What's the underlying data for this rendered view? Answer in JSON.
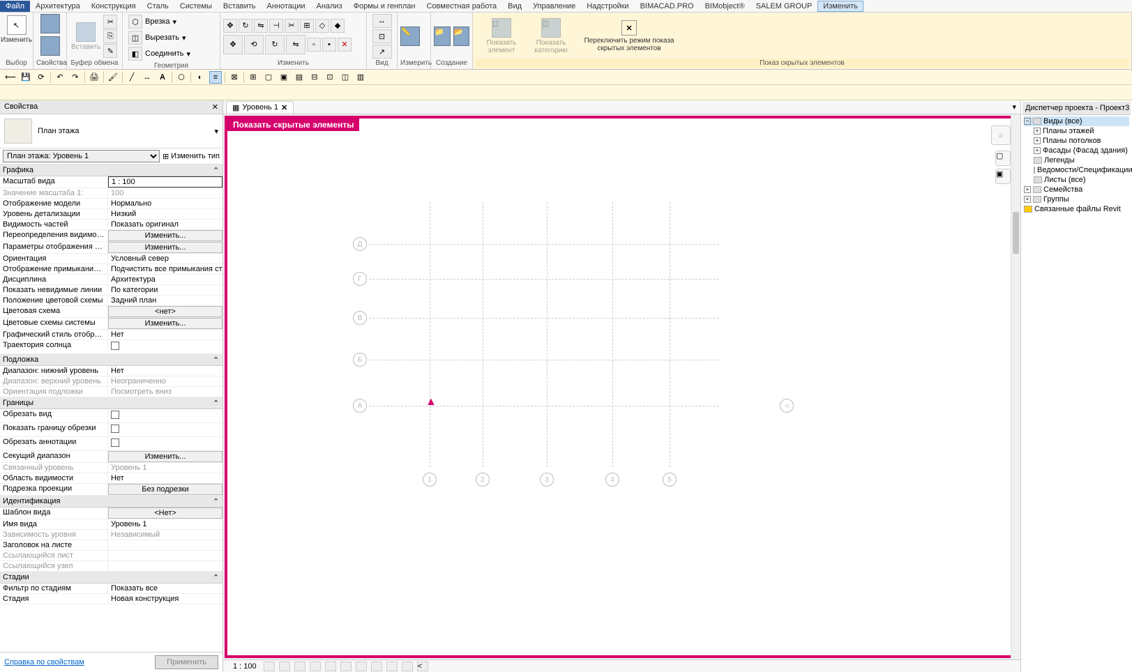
{
  "menubar": {
    "items": [
      "Файл",
      "Архитектура",
      "Конструкция",
      "Сталь",
      "Системы",
      "Вставить",
      "Аннотации",
      "Анализ",
      "Формы и генплан",
      "Совместная работа",
      "Вид",
      "Управление",
      "Надстройки",
      "BIMACAD.PRO",
      "BIMobject®",
      "SALEM GROUP",
      "Изменить"
    ]
  },
  "ribbon": {
    "groups": {
      "select": {
        "label": "Выбор",
        "btn": "Изменить"
      },
      "props": {
        "label": "Свойства"
      },
      "clipboard": {
        "label": "Буфер обмена",
        "btn": "Вставить"
      },
      "geometry": {
        "label": "Геометрия",
        "vrezka": "Врезка",
        "vyrezat": "Вырезать",
        "soedinit": "Соединить"
      },
      "modify": {
        "label": "Изменить"
      },
      "view": {
        "label": "Вид"
      },
      "measure": {
        "label": "Измерить"
      },
      "create": {
        "label": "Создание"
      },
      "hidden": {
        "label": "Показ скрытых элементов",
        "show_elem": "Показать элемент",
        "show_cat": "Показать категорию",
        "toggle": "Переключить режим показа скрытых элементов"
      }
    }
  },
  "props_panel": {
    "title": "Свойства",
    "type_label": "План этажа",
    "selector": "План этажа: Уровень 1",
    "edit_type": "Изменить тип",
    "sections": {
      "graphics": "Графика",
      "underlay": "Подложка",
      "bounds": "Границы",
      "ident": "Идентификация",
      "stages": "Стадии"
    },
    "rows": {
      "scale": {
        "label": "Масштаб вида",
        "value": "1 : 100"
      },
      "scale_val": {
        "label": "Значение масштаба    1:",
        "value": "100"
      },
      "model_disp": {
        "label": "Отображение модели",
        "value": "Нормально"
      },
      "detail": {
        "label": "Уровень детализации",
        "value": "Низкий"
      },
      "vis_parts": {
        "label": "Видимость частей",
        "value": "Показать оригинал"
      },
      "vis_over": {
        "label": "Переопределения видимости/...",
        "value": "Изменить..."
      },
      "gfx_params": {
        "label": "Параметры отображения граф...",
        "value": "Изменить..."
      },
      "orient": {
        "label": "Ориентация",
        "value": "Условный север"
      },
      "wall_join": {
        "label": "Отображение примыканий стен",
        "value": "Подчистить все примыкания стен"
      },
      "discipline": {
        "label": "Дисциплина",
        "value": "Архитектура"
      },
      "hidden_lines": {
        "label": "Показать невидимые линии",
        "value": "По категории"
      },
      "color_pos": {
        "label": "Положение цветовой схемы",
        "value": "Задний план"
      },
      "color_scheme": {
        "label": "Цветовая схема",
        "value": "<нет>"
      },
      "sys_colors": {
        "label": "Цветовые схемы системы",
        "value": "Изменить..."
      },
      "gfx_style": {
        "label": "Графический стиль отображе...",
        "value": "Нет"
      },
      "sun_path": {
        "label": "Траектория солнца",
        "value": ""
      },
      "range_low": {
        "label": "Диапазон: нижний уровень",
        "value": "Нет"
      },
      "range_high": {
        "label": "Диапазон: верхний уровень",
        "value": "Неограниченно"
      },
      "underlay_orient": {
        "label": "Ориентация подложки",
        "value": "Посмотреть вниз"
      },
      "crop_view": {
        "label": "Обрезать вид",
        "value": ""
      },
      "crop_border": {
        "label": "Показать границу обрезки",
        "value": ""
      },
      "crop_annot": {
        "label": "Обрезать аннотации",
        "value": ""
      },
      "section_range": {
        "label": "Секущий диапазон",
        "value": "Изменить..."
      },
      "assoc_level": {
        "label": "Связанный уровень",
        "value": "Уровень 1"
      },
      "vis_area": {
        "label": "Область видимости",
        "value": "Нет"
      },
      "proj_crop": {
        "label": "Подрезка проекции",
        "value": "Без подрезки"
      },
      "view_tmpl": {
        "label": "Шаблон вида",
        "value": "<Нет>"
      },
      "view_name": {
        "label": "Имя вида",
        "value": "Уровень 1"
      },
      "level_dep": {
        "label": "Зависимость уровня",
        "value": "Независимый"
      },
      "sheet_title": {
        "label": "Заголовок на листе",
        "value": ""
      },
      "ref_sheet": {
        "label": "Ссылающийся лист",
        "value": ""
      },
      "ref_node": {
        "label": "Ссылающийся узел",
        "value": ""
      },
      "stage_filter": {
        "label": "Фильтр по стадиям",
        "value": "Показать все"
      },
      "stage": {
        "label": "Стадия",
        "value": "Новая конструкция"
      }
    },
    "help": "Справка по свойствам",
    "apply": "Применить"
  },
  "view": {
    "tab_name": "Уровень 1",
    "overlay_label": "Показать скрытые элементы",
    "scale": "1 : 100",
    "grid_rows": [
      "Д",
      "Г",
      "В",
      "Б",
      "А"
    ],
    "grid_cols": [
      "1",
      "2",
      "3",
      "4",
      "5"
    ]
  },
  "browser": {
    "title": "Диспетчер проекта - Проект3",
    "items": [
      {
        "label": "Виды (все)",
        "level": 0,
        "expanded": true,
        "active": true
      },
      {
        "label": "Планы этажей",
        "level": 1,
        "expand": true
      },
      {
        "label": "Планы потолков",
        "level": 1,
        "expand": true
      },
      {
        "label": "Фасады (Фасад здания)",
        "level": 1,
        "expand": true
      },
      {
        "label": "Легенды",
        "level": 1
      },
      {
        "label": "Ведомости/Спецификации",
        "level": 1
      },
      {
        "label": "Листы (все)",
        "level": 1
      },
      {
        "label": "Семейства",
        "level": 0,
        "expand": true
      },
      {
        "label": "Группы",
        "level": 0,
        "expand": true
      },
      {
        "label": "Связанные файлы Revit",
        "level": 0
      }
    ]
  }
}
